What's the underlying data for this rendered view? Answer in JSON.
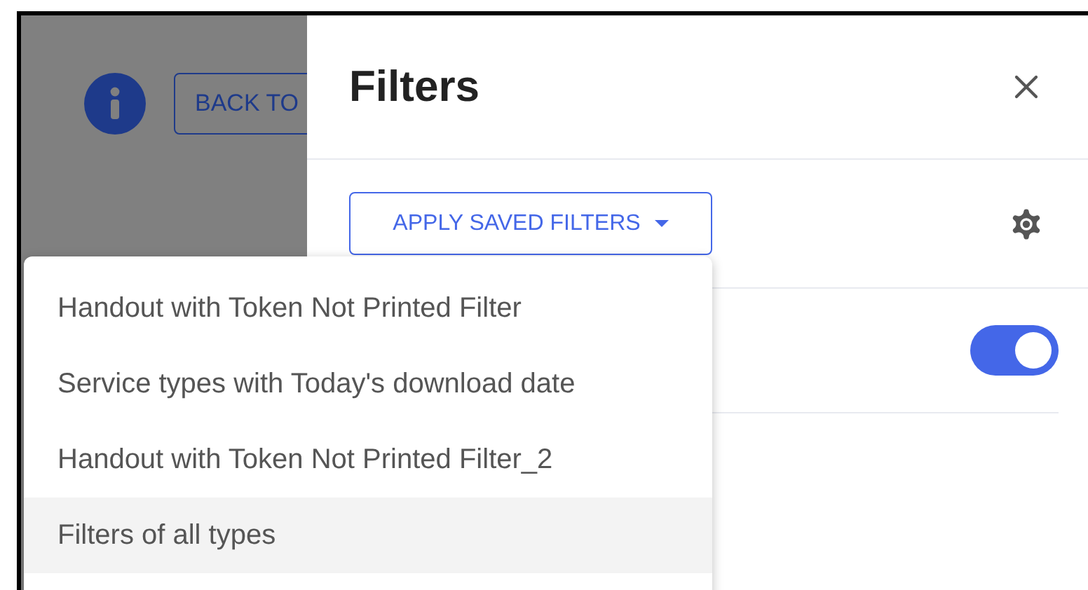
{
  "background": {
    "back_button": "BACK TO"
  },
  "panel": {
    "title": "Filters",
    "apply_button": "APPLY SAVED FILTERS",
    "toggle": {
      "on": true
    }
  },
  "menu": [
    {
      "label": "Handout with Token Not Printed Filter",
      "selected": false
    },
    {
      "label": "Service types with Today's download date",
      "selected": false
    },
    {
      "label": "Handout with Token Not Printed Filter_2",
      "selected": false
    },
    {
      "label": "Filters of all types",
      "selected": true
    }
  ]
}
